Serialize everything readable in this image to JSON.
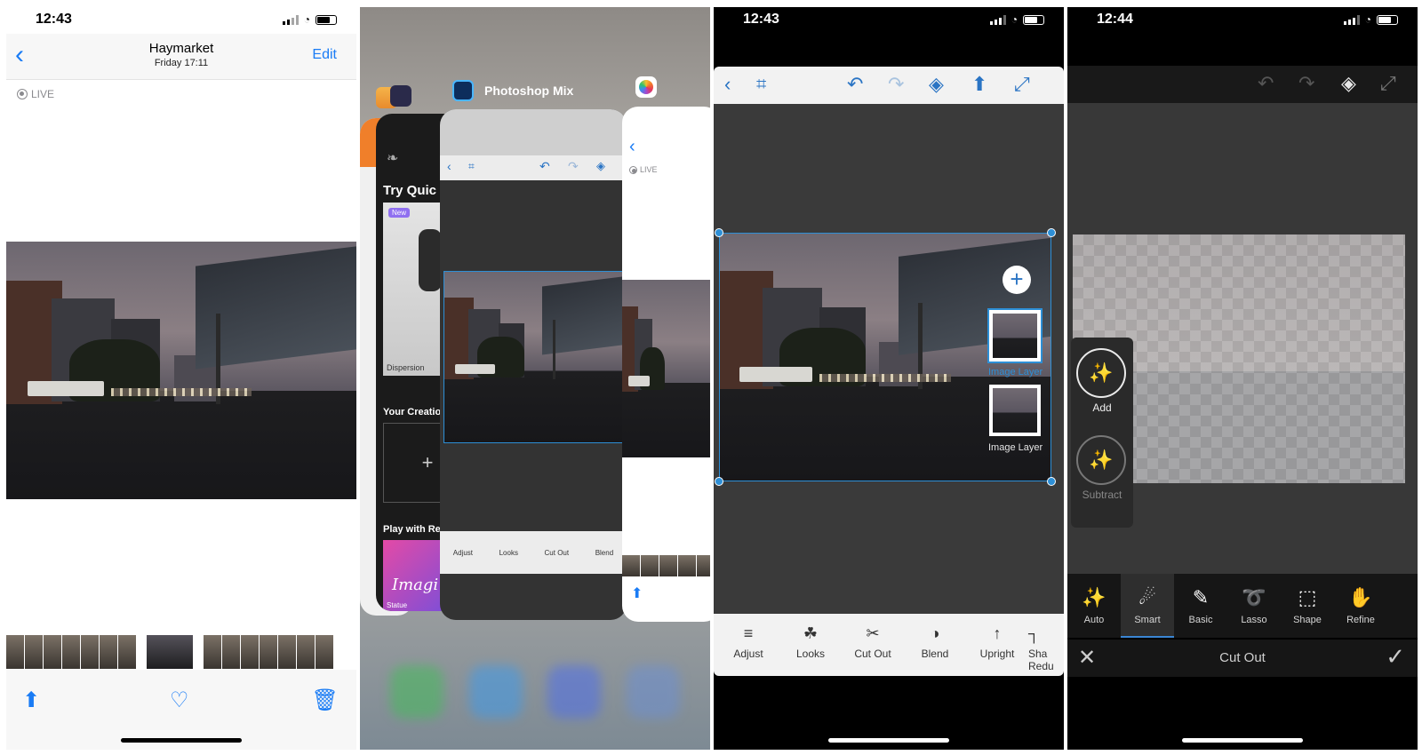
{
  "colors": {
    "ios_blue": "#1a7cf5",
    "ps_blue": "#2d8fd6",
    "selected_tool_underline": "#3a86d4"
  },
  "panel1": {
    "status": {
      "time": "12:43"
    },
    "nav": {
      "back_icon": "chevron-left-icon",
      "title": "Haymarket",
      "subtitle": "Friday  17:11",
      "edit_label": "Edit"
    },
    "live_label": "LIVE",
    "toolbar": {
      "share_icon": "share-icon",
      "favorite_icon": "heart-icon",
      "delete_icon": "trash-icon"
    }
  },
  "panel2": {
    "app_label": "Photoshop Mix",
    "card_texts": {
      "try_quick": "Try Quic",
      "new_badge": "New",
      "dispersion": "Dispersion",
      "your_creations": "Your Creatio",
      "play_with": "Play with Re",
      "imagi": "Imagi",
      "statue": "Statue",
      "live": "LIVE"
    },
    "mini_tools": [
      "Adjust",
      "Looks",
      "Cut Out",
      "Blend"
    ]
  },
  "panel3": {
    "status": {
      "time": "12:43"
    },
    "layers": [
      {
        "label": "Image Layer"
      },
      {
        "label": "Image Layer"
      }
    ],
    "tools": [
      {
        "label": "Adjust",
        "icon": "sliders-icon"
      },
      {
        "label": "Looks",
        "icon": "looks-icon"
      },
      {
        "label": "Cut Out",
        "icon": "scissors-icon"
      },
      {
        "label": "Blend",
        "icon": "blend-icon"
      },
      {
        "label": "Upright",
        "icon": "upright-icon"
      },
      {
        "label": "Sha",
        "icon": "shake-reduction-icon"
      }
    ],
    "tool_extra_line": "Redu"
  },
  "panel4": {
    "status": {
      "time": "12:44"
    },
    "brushes": {
      "add_label": "Add",
      "subtract_label": "Subtract"
    },
    "tools": [
      {
        "label": "Auto",
        "icon": "magic-wand-icon",
        "selected": false
      },
      {
        "label": "Smart",
        "icon": "smart-brush-icon",
        "selected": true
      },
      {
        "label": "Basic",
        "icon": "brush-icon",
        "selected": false
      },
      {
        "label": "Lasso",
        "icon": "lasso-icon",
        "selected": false
      },
      {
        "label": "Shape",
        "icon": "shape-icon",
        "selected": false
      },
      {
        "label": "Refine",
        "icon": "refine-icon",
        "selected": false
      }
    ],
    "bottom": {
      "title": "Cut Out"
    }
  }
}
